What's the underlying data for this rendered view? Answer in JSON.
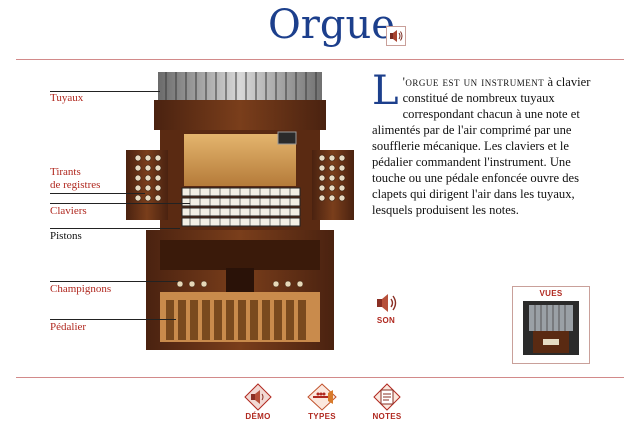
{
  "header": {
    "title": "Orgue"
  },
  "labels": {
    "tuyaux": "Tuyaux",
    "tirants_line1": "Tirants",
    "tirants_line2": "de registres",
    "claviers": "Claviers",
    "pistons": "Pistons",
    "champignons": "Champignons",
    "pedalier": "Pédalier"
  },
  "description": {
    "dropcap": "L",
    "lead": "'orgue est un instrument",
    "body": "à clavier constitué de nombreux tuyaux correspondant chacun à une note et alimentés par de l'air comprimé par une soufflerie mécanique. Les claviers et le pédalier commandent l'instrument. Une touche ou une pédale enfoncée ouvre des clapets qui dirigent l'air dans les tuyaux, lesquels produisent les notes."
  },
  "son": {
    "label": "SON"
  },
  "vues": {
    "label": "VUES"
  },
  "nav": [
    {
      "label": "DÉMO"
    },
    {
      "label": "TYPES"
    },
    {
      "label": "NOTES"
    }
  ],
  "colors": {
    "accent_red": "#b0281f",
    "title_blue": "#1c3f8c",
    "rule": "#d28a8a",
    "wood": "#6b3416"
  }
}
